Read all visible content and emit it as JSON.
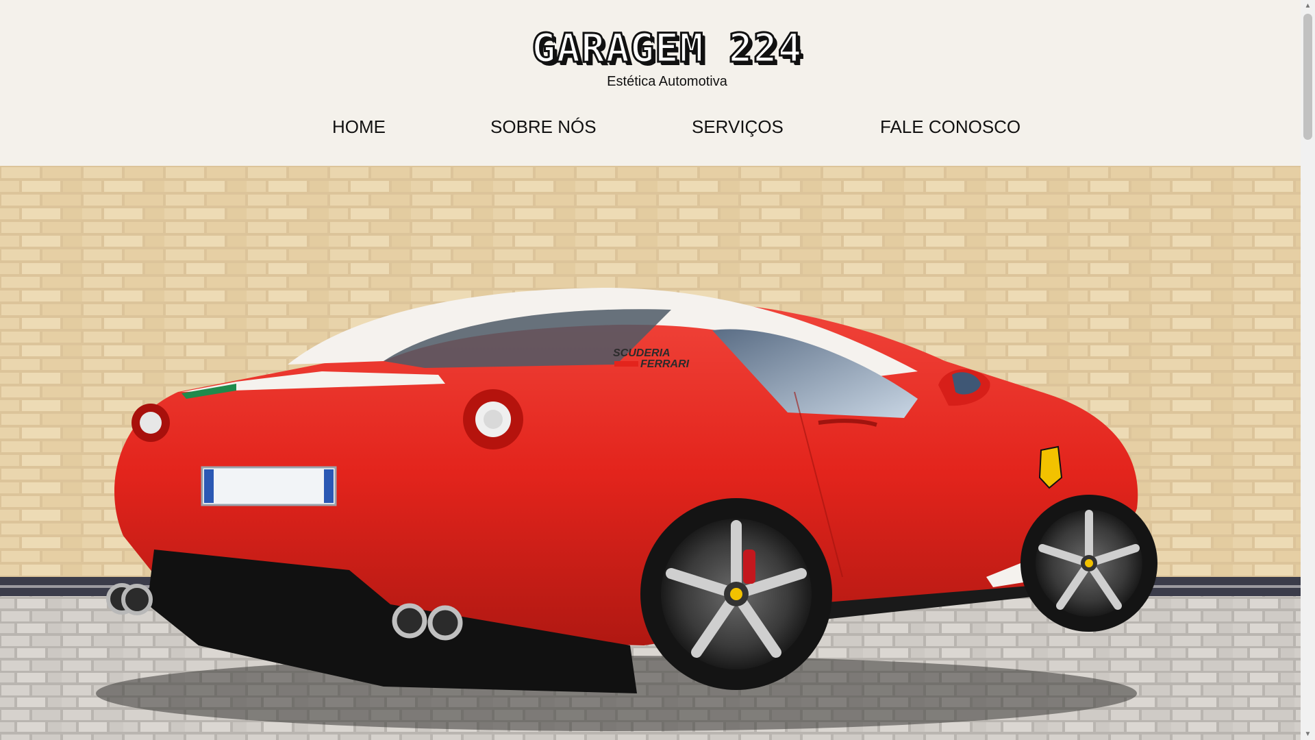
{
  "brand": {
    "name": "GARAGEM 224",
    "tagline": "Estética Automotiva"
  },
  "nav": {
    "items": [
      {
        "label": "HOME"
      },
      {
        "label": "SOBRE NÓS"
      },
      {
        "label": "SERVIÇOS"
      },
      {
        "label": "FALE CONOSCO"
      }
    ]
  },
  "hero": {
    "image": "red-ferrari-car-photo",
    "decal_line1": "SCUDERIA",
    "decal_line2": "FERRARI"
  },
  "colors": {
    "header_bg": "#f4f1eb",
    "car_red": "#e3241c",
    "brick": "#e4cda3"
  }
}
